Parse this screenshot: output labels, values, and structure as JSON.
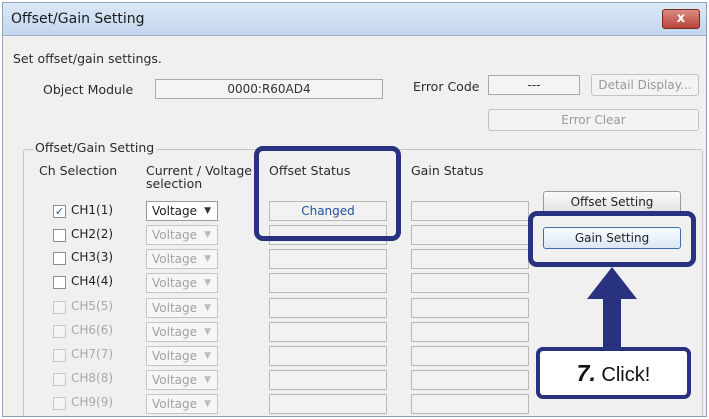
{
  "window": {
    "title": "Offset/Gain Setting",
    "close_label": "x"
  },
  "instructions": "Set offset/gain settings.",
  "object_module": {
    "label": "Object Module",
    "value": "0000:R60AD4"
  },
  "error_code": {
    "label": "Error Code",
    "value": "---"
  },
  "buttons": {
    "detail_display": "Detail Display...",
    "error_clear": "Error Clear",
    "offset_setting": "Offset Setting",
    "gain_setting": "Gain Setting"
  },
  "group": {
    "label": "Offset/Gain Setting",
    "headers": {
      "ch_selection": "Ch Selection",
      "current_voltage_1": "Current / Voltage",
      "current_voltage_2": "selection",
      "offset_status": "Offset Status",
      "gain_status": "Gain Status"
    }
  },
  "channels": [
    {
      "label": "CH1(1)",
      "checked": true,
      "enabled": true,
      "selection": "Voltage",
      "offset_status": "Changed",
      "gain_status": ""
    },
    {
      "label": "CH2(2)",
      "checked": false,
      "enabled": true,
      "selection": "Voltage",
      "offset_status": "",
      "gain_status": ""
    },
    {
      "label": "CH3(3)",
      "checked": false,
      "enabled": true,
      "selection": "Voltage",
      "offset_status": "",
      "gain_status": ""
    },
    {
      "label": "CH4(4)",
      "checked": false,
      "enabled": true,
      "selection": "Voltage",
      "offset_status": "",
      "gain_status": ""
    },
    {
      "label": "CH5(5)",
      "checked": false,
      "enabled": false,
      "selection": "Voltage",
      "offset_status": "",
      "gain_status": ""
    },
    {
      "label": "CH6(6)",
      "checked": false,
      "enabled": false,
      "selection": "Voltage",
      "offset_status": "",
      "gain_status": ""
    },
    {
      "label": "CH7(7)",
      "checked": false,
      "enabled": false,
      "selection": "Voltage",
      "offset_status": "",
      "gain_status": ""
    },
    {
      "label": "CH8(8)",
      "checked": false,
      "enabled": false,
      "selection": "Voltage",
      "offset_status": "",
      "gain_status": ""
    },
    {
      "label": "CH9(9)",
      "checked": false,
      "enabled": false,
      "selection": "Voltage",
      "offset_status": "",
      "gain_status": ""
    }
  ],
  "callout": {
    "step": "7.",
    "text": "Click!"
  },
  "colors": {
    "highlight": "#28327e",
    "changed_text": "#2050a0"
  }
}
